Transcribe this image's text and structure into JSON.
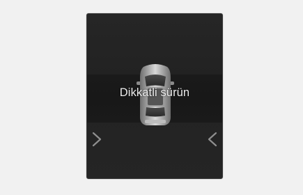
{
  "display": {
    "message": "Dikkatli sürün",
    "left_indicator_icon": "chevron-right-icon",
    "right_indicator_icon": "chevron-left-icon",
    "vehicle_icon": "car-top-view-icon"
  },
  "colors": {
    "background": "#f1f1f1",
    "screen": "#242424",
    "text": "#ececec",
    "arrow": "#8f8f8f"
  }
}
